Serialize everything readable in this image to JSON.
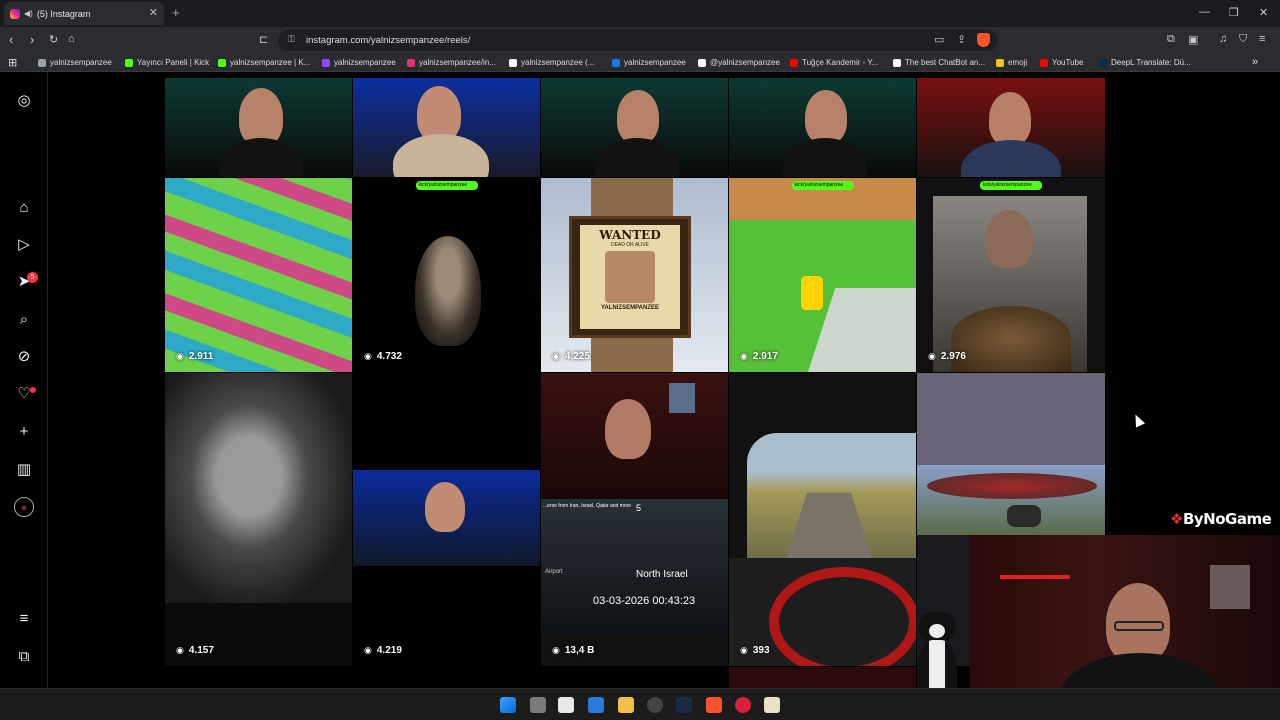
{
  "browser": {
    "tab_title": "(5) Instagram",
    "tab_close": "✕",
    "new_tab": "+",
    "url": "instagram.com/yalnizsempanzee/reels/",
    "window_controls": [
      "—",
      "❐",
      "✕"
    ],
    "bookmarks": [
      {
        "label": "yalnizsempanzee",
        "icon": "globe-icon",
        "color": "#9aa0a6"
      },
      {
        "label": "Yayıncı Paneli | Kick",
        "icon": "kick-icon",
        "color": "#53fc18"
      },
      {
        "label": "yalnizsempanzee | K...",
        "icon": "kick-icon",
        "color": "#53fc18"
      },
      {
        "label": "yalnizsempanzee",
        "icon": "twitch-icon",
        "color": "#9146ff"
      },
      {
        "label": "yalnizsempanzee/in...",
        "icon": "instagram-icon",
        "color": "#e1306c"
      },
      {
        "label": "yalnizsempanzee (...",
        "icon": "tiktok-icon",
        "color": "#ffffff"
      },
      {
        "label": "yalnizsempanzee",
        "icon": "facebook-icon",
        "color": "#1877f2"
      },
      {
        "label": "@yalnizsempanzee",
        "icon": "x-icon",
        "color": "#ffffff"
      },
      {
        "label": "Tuğçe Kandemir - Y...",
        "icon": "youtube-icon",
        "color": "#ff0000"
      },
      {
        "label": "The best ChatBot an...",
        "icon": "chatbot-icon",
        "color": "#ffffff"
      },
      {
        "label": "emoji",
        "icon": "emoji-icon",
        "color": "#f5c518"
      },
      {
        "label": "YouTube",
        "icon": "youtube-icon",
        "color": "#ff0000"
      },
      {
        "label": "DeepL Translate: Dü...",
        "icon": "deepl-icon",
        "color": "#0f2b46"
      }
    ],
    "bookmarks_more": "»"
  },
  "sidebar": {
    "items": [
      {
        "name": "instagram-logo-icon",
        "glyph": "◎"
      },
      {
        "name": "home-icon",
        "glyph": "⌂"
      },
      {
        "name": "reels-icon",
        "glyph": "▷"
      },
      {
        "name": "messages-icon",
        "glyph": "➤"
      },
      {
        "name": "search-icon",
        "glyph": "⌕"
      },
      {
        "name": "explore-icon",
        "glyph": "⊘"
      },
      {
        "name": "notifications-icon",
        "glyph": "♡"
      },
      {
        "name": "create-icon",
        "glyph": "+"
      },
      {
        "name": "dashboard-icon",
        "glyph": "▥"
      },
      {
        "name": "profile-avatar-icon",
        "glyph": "●"
      },
      {
        "name": "more-menu-icon",
        "glyph": "≡"
      },
      {
        "name": "also-from-meta-icon",
        "glyph": "⧉"
      }
    ],
    "messages_badge": "5"
  },
  "reels": {
    "row2": [
      {
        "views": "2.911",
        "kick": false
      },
      {
        "views": "4.732",
        "kick": true
      },
      {
        "views": "4.225",
        "kick": true
      },
      {
        "views": "2.917",
        "kick": true
      },
      {
        "views": "2.976",
        "kick": true
      }
    ],
    "row3": [
      {
        "views": "4.157"
      },
      {
        "views": "4.219"
      },
      {
        "views": "13,4 B"
      },
      {
        "views": "393"
      }
    ],
    "kick_badge_text": "kick/yalnizsempanzee",
    "wanted_poster": {
      "title": "WANTED",
      "subtitle": "DEAD OR ALIVE",
      "name": "YALNIZSEMPANZEE"
    },
    "news_overlay": {
      "headline": "...erse from Iran, Israel, Qatar and more",
      "number": "5",
      "location": "North Israel",
      "timestamp": "03-03-2026 00:43:23",
      "airport": "Airport"
    }
  },
  "overlay": {
    "watermark": "ByNoGame"
  },
  "colors": {
    "bg": "#000000",
    "kick_green": "#53fc18",
    "notification_red": "#ff3040",
    "brave_orange": "#fb542b"
  }
}
